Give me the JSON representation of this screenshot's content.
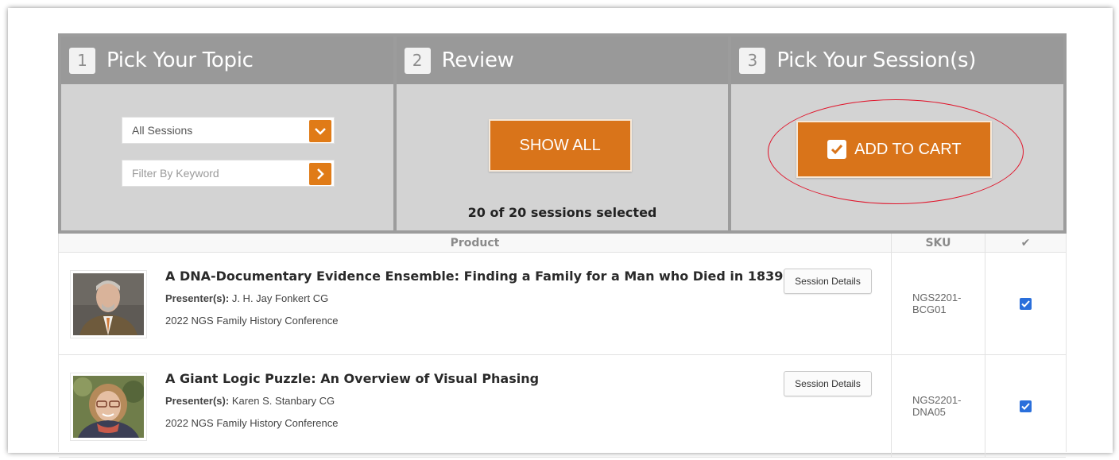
{
  "steps": [
    {
      "number": "1",
      "title": "Pick Your Topic"
    },
    {
      "number": "2",
      "title": "Review"
    },
    {
      "number": "3",
      "title": "Pick Your Session(s)"
    }
  ],
  "topic": {
    "select_value": "All Sessions",
    "filter_placeholder": "Filter By Keyword"
  },
  "review": {
    "show_all_label": "SHOW ALL",
    "selected_count": "20 of 20 sessions selected"
  },
  "cart": {
    "add_label": "ADD TO CART"
  },
  "table": {
    "headers": {
      "product": "Product",
      "sku": "SKU",
      "check": "✔"
    },
    "rows": [
      {
        "title": "A DNA-Documentary Evidence Ensemble: Finding a Family for a Man who Died in 1839",
        "presenter_label": "Presenter(s):",
        "presenter": "J. H. Jay Fonkert CG",
        "conference": "2022 NGS Family History Conference",
        "details_label": "Session Details",
        "sku_line1": "NGS2201-",
        "sku_line2": "BCG01",
        "checked": true
      },
      {
        "title": "A Giant Logic Puzzle: An Overview of Visual Phasing",
        "presenter_label": "Presenter(s):",
        "presenter": "Karen S. Stanbary CG",
        "conference": "2022 NGS Family History Conference",
        "details_label": "Session Details",
        "sku_line1": "NGS2201-",
        "sku_line2": "DNA05",
        "checked": true
      }
    ]
  },
  "colors": {
    "accent": "#d9741a",
    "annotation": "#e0142a",
    "checkbox": "#2a6fdb"
  }
}
